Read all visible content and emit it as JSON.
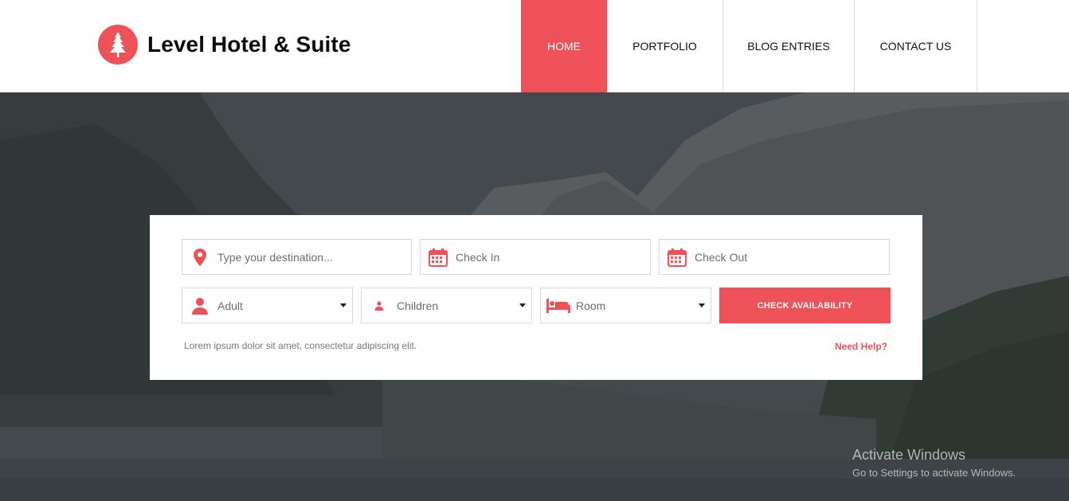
{
  "brand": {
    "title": "Level Hotel & Suite",
    "logo_icon": "tree-icon"
  },
  "nav": {
    "items": [
      {
        "label": "HOME",
        "active": true
      },
      {
        "label": "PORTFOLIO",
        "active": false
      },
      {
        "label": "BLOG ENTRIES",
        "active": false
      },
      {
        "label": "CONTACT US",
        "active": false
      }
    ]
  },
  "booking": {
    "destination_placeholder": "Type your destination...",
    "check_in_placeholder": "Check In",
    "check_out_placeholder": "Check Out",
    "adult_label": "Adult",
    "children_label": "Children",
    "room_label": "Room",
    "submit_label": "CHECK AVAILABILITY",
    "note": "Lorem ipsum dolor sit amet, consectetur adipiscing elit.",
    "help_label": "Need Help?"
  },
  "watermark": {
    "title": "Activate Windows",
    "subtitle": "Go to Settings to activate Windows."
  },
  "colors": {
    "accent": "#ee5157",
    "text_dark": "#111111"
  }
}
